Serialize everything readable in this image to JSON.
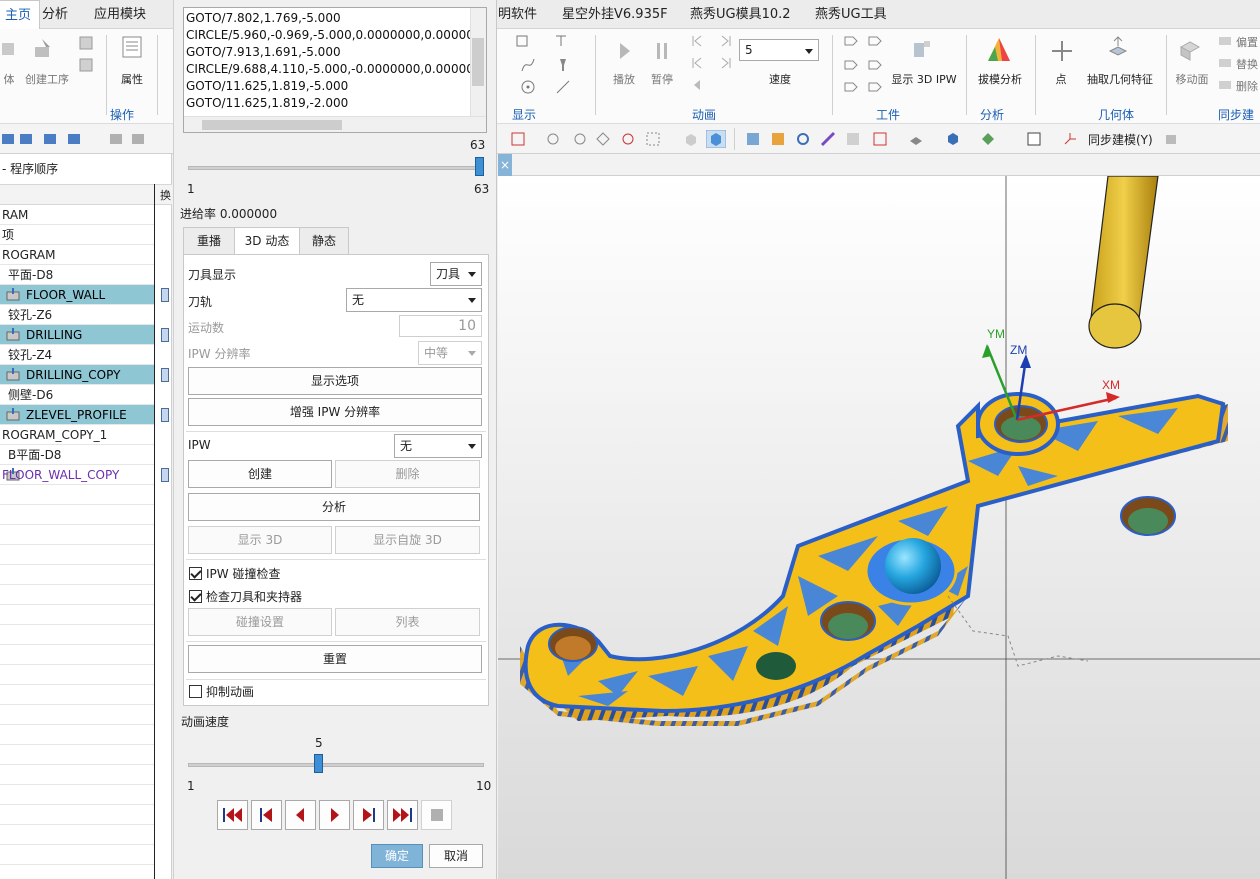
{
  "ribbon": {
    "tabs": [
      "主页",
      "分析",
      "应用模块",
      "明软件",
      "星空外挂V6.935F",
      "燕秀UG模具10.2",
      "燕秀UG工具"
    ],
    "left_labels": {
      "fragment_body": "体",
      "create_op": "创建工序",
      "properties": "属性",
      "operations_group": "操作"
    },
    "display_group": "显示",
    "animation": {
      "play": "播放",
      "pause": "暂停",
      "speed_value": "5",
      "speed_label": "速度",
      "group": "动画"
    },
    "workpiece": {
      "show_ipw": "显示 3D IPW",
      "group": "工件"
    },
    "analysis": {
      "draft": "拔模分析",
      "group": "分析"
    },
    "geometry": {
      "point": "点",
      "extract": "抽取几何特征",
      "group": "几何体"
    },
    "sync": {
      "move_face": "移动面",
      "offset": "偏置",
      "replace": "替换",
      "delete": "删除",
      "group": "同步建模"
    },
    "toolbar_row": {
      "sync_model": "同步建模(Y)"
    }
  },
  "navigator": {
    "title": "- 程序顺序",
    "col2": "换",
    "rows": [
      {
        "text": "RAM",
        "type": "plain"
      },
      {
        "text": "项",
        "type": "plain"
      },
      {
        "text": "ROGRAM",
        "type": "plain"
      },
      {
        "text": "平面-D8",
        "type": "plain"
      },
      {
        "text": "FLOOR_WALL",
        "type": "op"
      },
      {
        "text": "铰孔-Z6",
        "type": "plain"
      },
      {
        "text": "DRILLING",
        "type": "op"
      },
      {
        "text": "铰孔-Z4",
        "type": "plain"
      },
      {
        "text": "DRILLING_COPY",
        "type": "op"
      },
      {
        "text": "侧壁-D6",
        "type": "plain"
      },
      {
        "text": "ZLEVEL_PROFILE",
        "type": "op"
      },
      {
        "text": "ROGRAM_COPY_1",
        "type": "plain"
      },
      {
        "text": "B平面-D8",
        "type": "plain"
      },
      {
        "text": "FLOOR_WALL_COPY",
        "type": "purple"
      }
    ]
  },
  "dialog": {
    "code_lines": [
      "GOTO/7.802,1.769,-5.000",
      "CIRCLE/5.960,-0.969,-5.000,0.0000000,0.0000000,1",
      "GOTO/7.913,1.691,-5.000",
      "CIRCLE/9.688,4.110,-5.000,-0.0000000,0.0000000,-",
      "GOTO/11.625,1.819,-5.000",
      "GOTO/11.625,1.819,-2.000"
    ],
    "motion_slider": {
      "value": "63",
      "min": "1",
      "max": "63",
      "position": 1.0
    },
    "feedrate": "进给率 0.000000",
    "tabs": [
      "重播",
      "3D 动态",
      "静态"
    ],
    "tool_display_label": "刀具显示",
    "tool_display_value": "刀具",
    "toolpath_label": "刀轨",
    "toolpath_value": "无",
    "motion_count_label": "运动数",
    "motion_count_value": "10",
    "ipw_res_label": "IPW 分辨率",
    "ipw_res_value": "中等",
    "show_options": "显示选项",
    "enhance_ipw": "增强 IPW 分辨率",
    "ipw_label": "IPW",
    "ipw_value": "无",
    "create": "创建",
    "delete": "删除",
    "analyze": "分析",
    "show_3d": "显示 3D",
    "show_rotate_3d": "显示自旋 3D",
    "ipw_collision": "IPW 碰撞检查",
    "check_tool_holder": "检查刀具和夹持器",
    "collision_settings": "碰撞设置",
    "list": "列表",
    "reset": "重置",
    "suppress_anim": "抑制动画",
    "anim_speed_label": "动画速度",
    "anim_slider": {
      "value": "5",
      "min": "1",
      "max": "10",
      "position": 0.44
    },
    "ok": "确定",
    "cancel": "取消"
  },
  "viewport": {
    "axis_y": "YM",
    "axis_z": "ZM",
    "axis_x": "XM"
  },
  "colors": {
    "accent": "#1a5fb4",
    "part_blue": "#3b82e6",
    "part_yellow": "#f5bf1a",
    "tool": "#e6c53f",
    "op_row": "#8fc6d4"
  }
}
